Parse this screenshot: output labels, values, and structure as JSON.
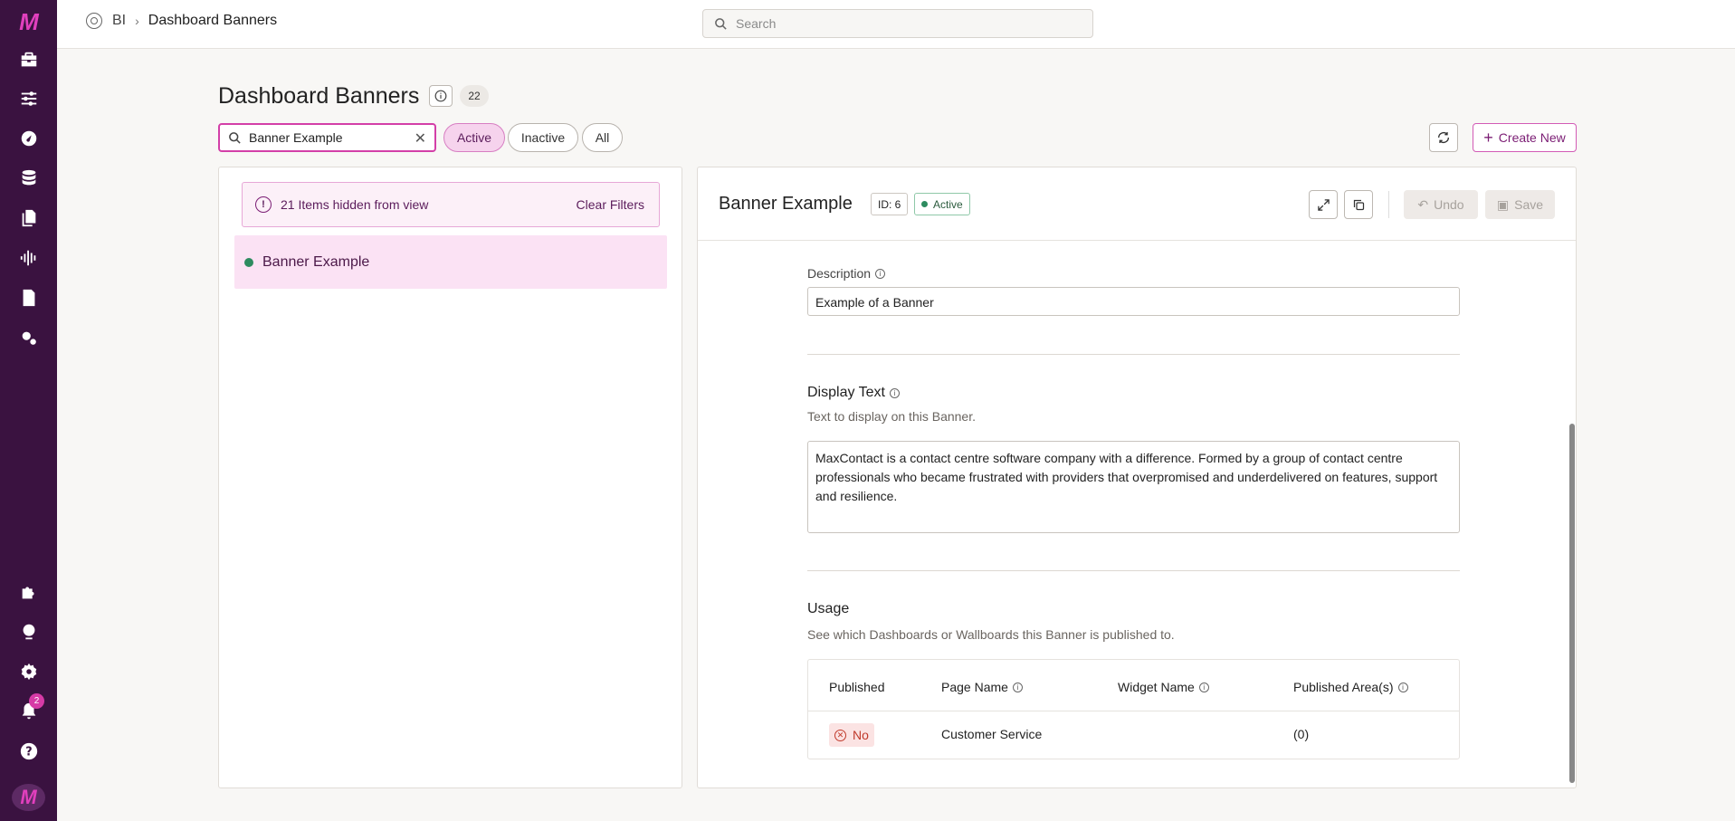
{
  "app": {
    "logo_glyph": "M",
    "breadcrumb": {
      "root": "BI",
      "current": "Dashboard Banners"
    },
    "search_placeholder": "Search",
    "notification_count": "2"
  },
  "header": {
    "title": "Dashboard Banners",
    "count": "22",
    "filter_value": "Banner Example",
    "pills": [
      "Active",
      "Inactive",
      "All"
    ],
    "create_label": "Create New"
  },
  "list": {
    "hidden_message": "21 Items hidden from view",
    "clear_filters": "Clear Filters",
    "items": [
      {
        "label": "Banner Example",
        "status_color": "#2d8b5f"
      }
    ]
  },
  "detail": {
    "title": "Banner Example",
    "id_label": "ID: 6",
    "status": "Active",
    "undo_label": "Undo",
    "save_label": "Save",
    "description_label": "Description",
    "description_value": "Example of a Banner",
    "display_text_label": "Display Text",
    "display_text_help": "Text to display on this Banner.",
    "display_text_value": "MaxContact is a contact centre software company with a difference. Formed by a group of contact centre professionals who became frustrated with providers that overpromised and underdelivered on features, support and resilience.",
    "usage_label": "Usage",
    "usage_help": "See which Dashboards or Wallboards this Banner is published to.",
    "table": {
      "headers": [
        "Published",
        "Page Name",
        "Widget Name",
        "Published Area(s)"
      ],
      "rows": [
        {
          "published": "No",
          "page_name": "Customer Service",
          "widget_name": "",
          "areas": "(0)"
        }
      ]
    }
  },
  "colors": {
    "rail": "#3a1240",
    "accent": "#d33fa8",
    "active_green": "#2d8b5f"
  }
}
